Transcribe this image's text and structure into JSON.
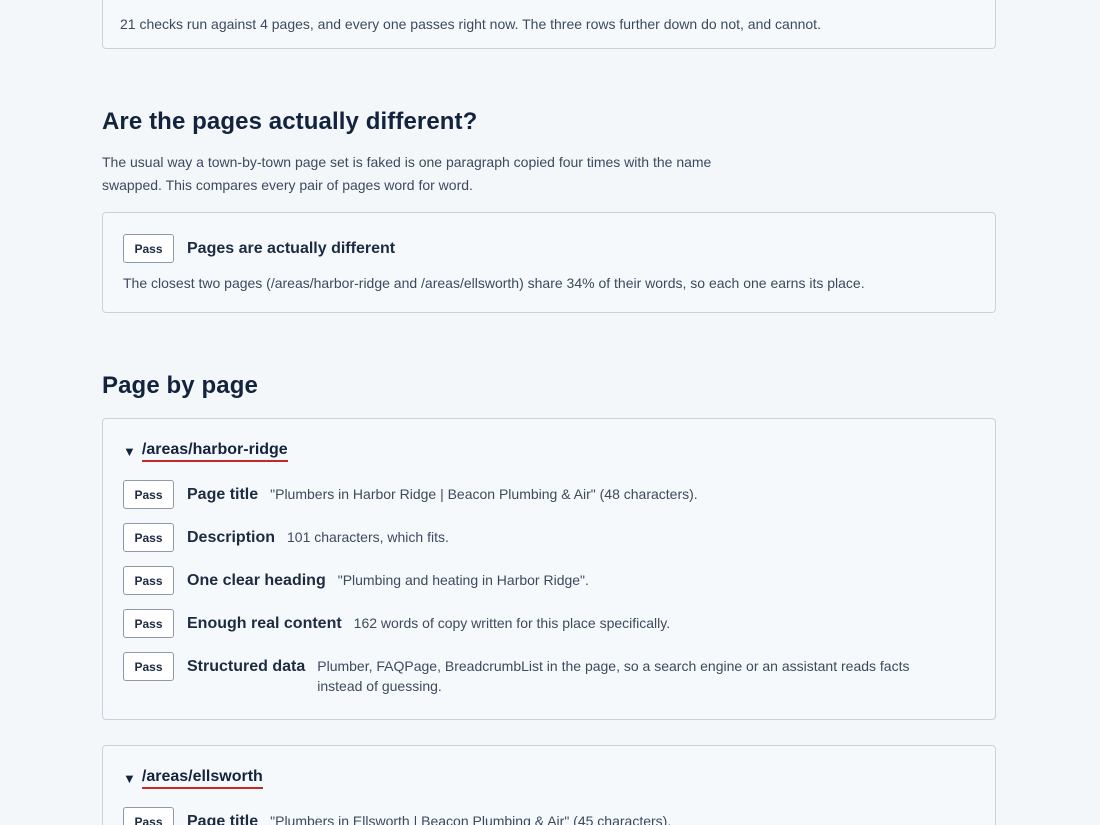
{
  "summary": {
    "text": "21 checks run against 4 pages, and every one passes right now. The three rows further down do not, and cannot."
  },
  "difference": {
    "heading": "Are the pages actually different?",
    "lede": "The usual way a town-by-town page set is faked is one paragraph copied four times with the name swapped. This compares every pair of pages word for word.",
    "badge": "Pass",
    "title": "Pages are actually different",
    "detail": "The closest two pages (/areas/harbor-ridge and /areas/ellsworth) share 34% of their words, so each one earns its place."
  },
  "page_by_page": {
    "heading": "Page by page",
    "pages": [
      {
        "path": "/areas/harbor-ridge",
        "checks": [
          {
            "badge": "Pass",
            "title": "Page title",
            "detail": "\"Plumbers in Harbor Ridge | Beacon Plumbing & Air\" (48 characters)."
          },
          {
            "badge": "Pass",
            "title": "Description",
            "detail": "101 characters, which fits."
          },
          {
            "badge": "Pass",
            "title": "One clear heading",
            "detail": "\"Plumbing and heating in Harbor Ridge\"."
          },
          {
            "badge": "Pass",
            "title": "Enough real content",
            "detail": "162 words of copy written for this place specifically."
          },
          {
            "badge": "Pass",
            "title": "Structured data",
            "detail": "Plumber, FAQPage, BreadcrumbList in the page, so a search engine or an assistant reads facts instead of guessing."
          }
        ]
      },
      {
        "path": "/areas/ellsworth",
        "checks": [
          {
            "badge": "Pass",
            "title": "Page title",
            "detail": "\"Plumbers in Ellsworth | Beacon Plumbing & Air\" (45 characters)."
          }
        ]
      }
    ]
  }
}
